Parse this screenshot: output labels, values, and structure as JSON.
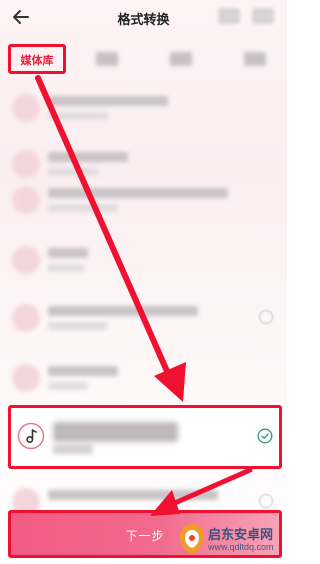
{
  "header": {
    "title": "格式转换",
    "back_icon": "arrow-left-icon"
  },
  "tabs": {
    "active_label": "媒体库"
  },
  "list": {
    "selected_item": {
      "icon": "music-note-icon",
      "status_icon": "check-circle-icon"
    }
  },
  "bottom": {
    "next_label": "下一步"
  },
  "watermark": {
    "line1": "启东安卓网",
    "line2": "www.qdltdq.com"
  },
  "colors": {
    "highlight": "#f0102f",
    "accent_pink": "#f25b83",
    "check_green": "#3a9a7a"
  }
}
